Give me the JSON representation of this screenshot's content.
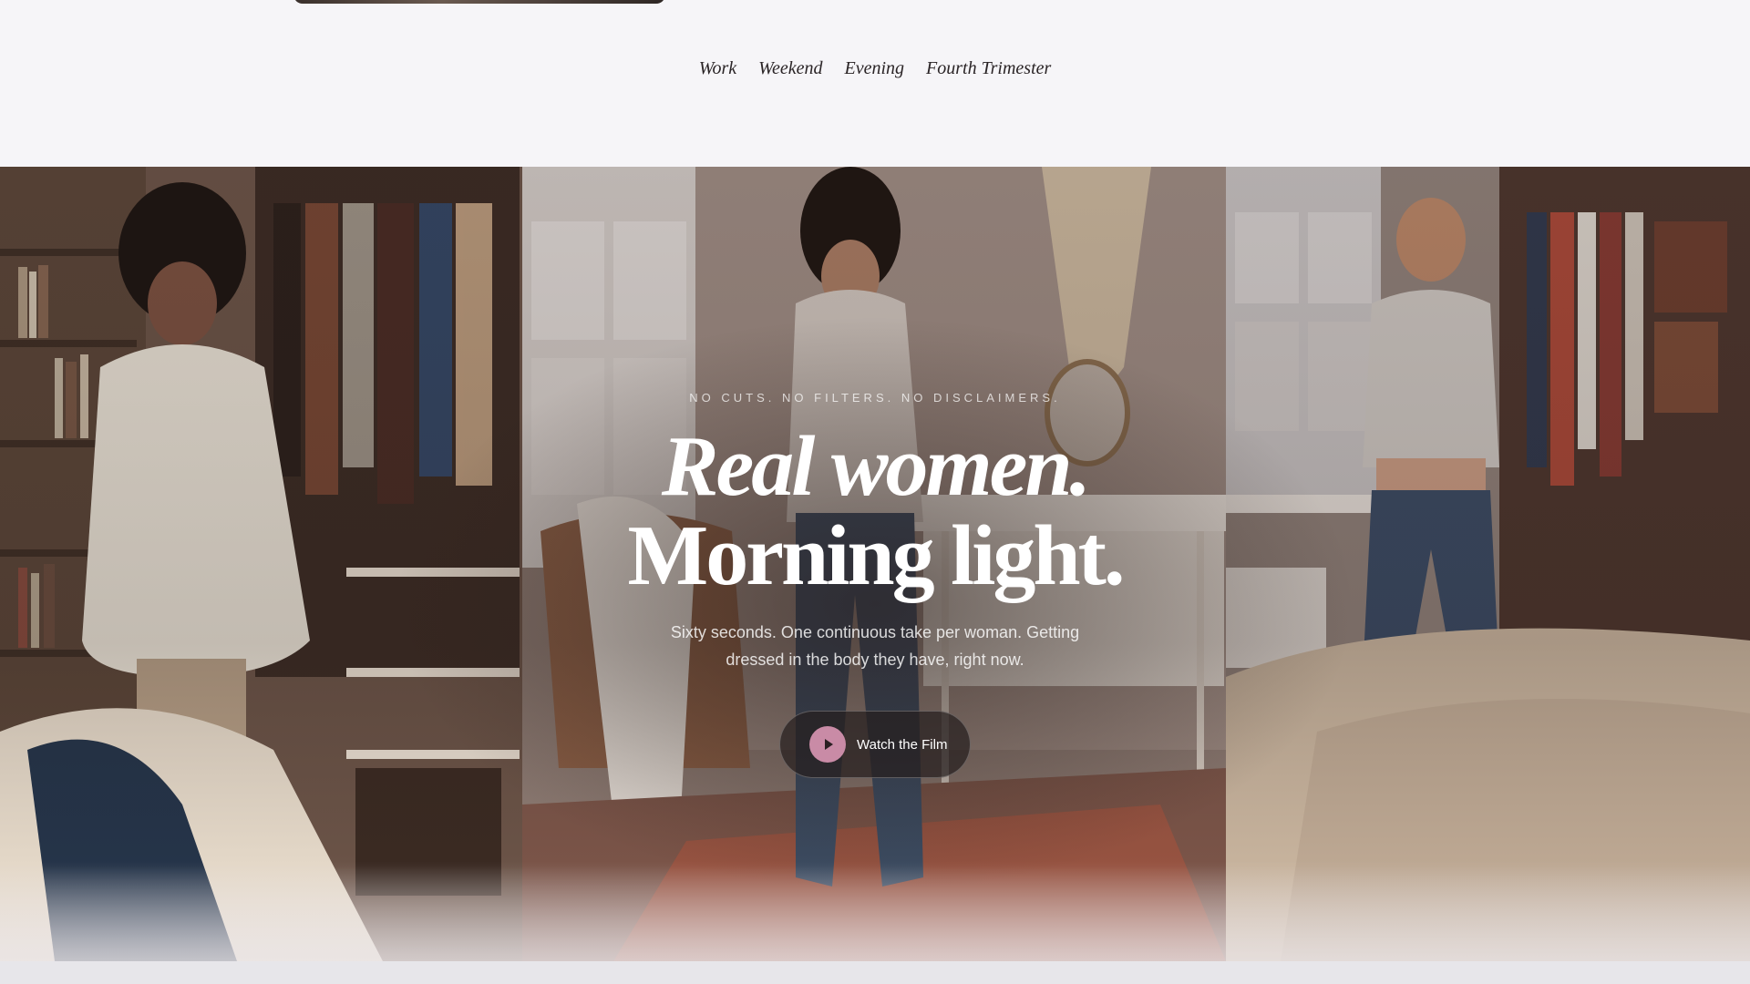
{
  "nav": {
    "items": [
      {
        "label": "Work"
      },
      {
        "label": "Weekend"
      },
      {
        "label": "Evening"
      },
      {
        "label": "Fourth Trimester"
      }
    ]
  },
  "hero": {
    "eyebrow": "NO CUTS. NO FILTERS. NO DISCLAIMERS.",
    "headline_line1": "Real women.",
    "headline_line2": "Morning light.",
    "subcopy": "Sixty seconds. One continuous take per woman. Getting dressed in the body they have, right now.",
    "cta_label": "Watch the Film",
    "cta_icon": "play-icon"
  },
  "colors": {
    "page_bg": "#f6f5f8",
    "accent_pink": "#c98ba6",
    "button_bg": "#261e1e",
    "headline": "#ffffff"
  }
}
